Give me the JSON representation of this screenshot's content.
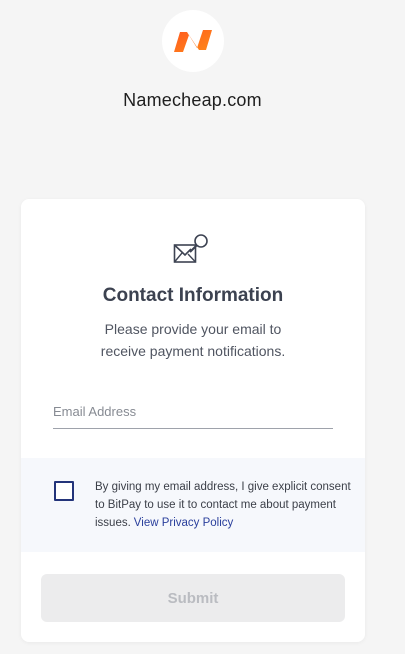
{
  "merchant": {
    "name": "Namecheap.com",
    "logo_icon": "namecheap-logo",
    "brand_color": "#ff6600"
  },
  "card": {
    "icon": "email-search-icon",
    "title": "Contact Information",
    "subtitle": "Please provide your email to receive payment notifications."
  },
  "email": {
    "placeholder": "Email Address",
    "value": ""
  },
  "consent": {
    "text": "By giving my email address, I give explicit consent to BitPay to use it to contact me about payment issues.",
    "link_label": "View Privacy Policy",
    "checked": false,
    "checkbox_color": "#23347a"
  },
  "submit": {
    "label": "Submit",
    "enabled": false
  }
}
